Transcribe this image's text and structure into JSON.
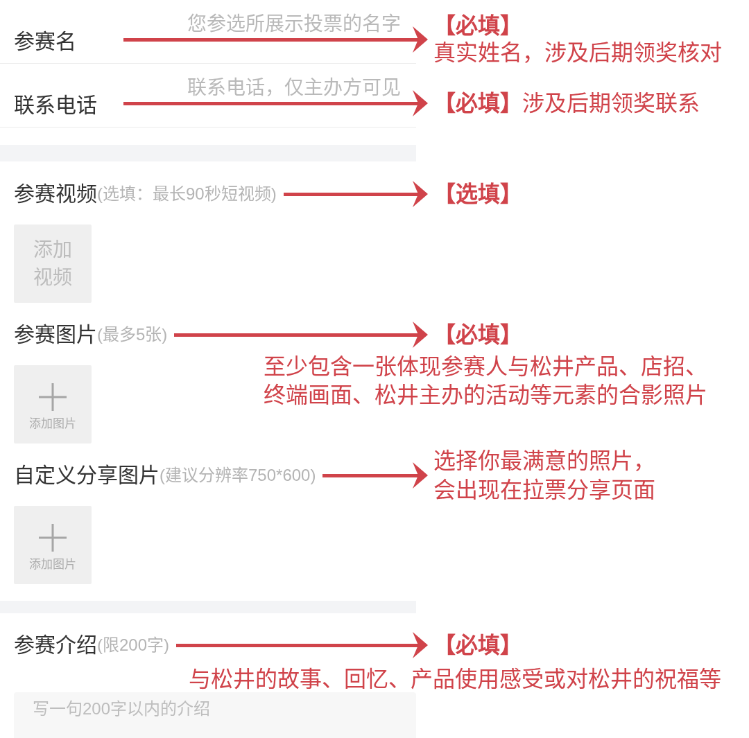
{
  "sections": [
    {
      "fields": [
        {
          "kind": "text",
          "label": "参赛名",
          "placeholder": "您参选所展示投票的名字",
          "note": {
            "tag": "【必填】",
            "text": "真实姓名，涉及后期领奖核对"
          }
        },
        {
          "kind": "text",
          "label": "联系电话",
          "placeholder": "联系电话，仅主办方可见",
          "note": {
            "text": "**【必填】**涉及后期领奖联系"
          }
        }
      ]
    },
    {
      "fields": [
        {
          "kind": "video",
          "label": "参赛视频",
          "hint": "(选填：最长90秒短视频)",
          "button": "添加视频",
          "note": {
            "tag": "【选填】"
          }
        },
        {
          "kind": "image",
          "label": "参赛图片",
          "hint": "(最多5张)",
          "button": "添加图片",
          "note": {
            "tag": "【必填】",
            "text": "至少包含一张体现参赛人与松井产品、店招、终端画面、松井主办的活动等元素的合影照片"
          }
        },
        {
          "kind": "image",
          "label": "自定义分享图片",
          "hint": "(建议分辨率750*600)",
          "button": "添加图片",
          "note": {
            "text": "选择你最满意的照片，会出现在拉票分享页面"
          }
        }
      ]
    },
    {
      "fields": [
        {
          "kind": "textarea",
          "label": "参赛介绍",
          "hint": "(限200字)",
          "placeholder": "写一句200字以内的介绍",
          "note": {
            "tag": "【必填】",
            "text": "与松井的故事、回忆、产品使用感受或对松井的祝福等"
          }
        }
      ]
    }
  ]
}
